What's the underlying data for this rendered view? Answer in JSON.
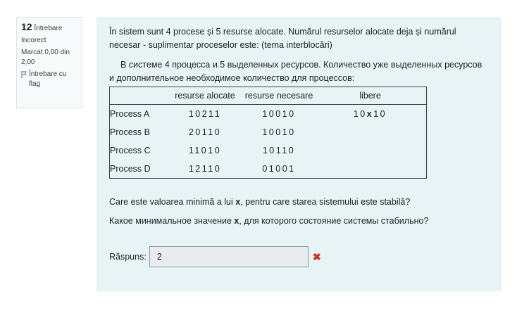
{
  "info": {
    "question_number": "12",
    "question_word": "Întrebare",
    "state": "Incorect",
    "grade": "Marcat 0,00 din 2,00",
    "flag_label": "Întrebare cu flag"
  },
  "question": {
    "text_ro": "În sistem sunt 4 procese și 5 resurse alocate. Numărul resurselor alocate deja și numărul necesar - suplimentar proceselor este:  (tema interblocări)",
    "text_ru": "В системе 4 процесса и 5 выделенных ресурсов. Количество уже выделенных ресурсов и дополнительное необходимое количество для процессов:",
    "table": {
      "headers": [
        "",
        "resurse alocate",
        "resurse necesare",
        "libere"
      ],
      "rows": [
        {
          "name": "Process A",
          "alocate": "10211",
          "necesare": "10010",
          "libere_pre": "10",
          "libere_x": "x",
          "libere_post": "10"
        },
        {
          "name": "Process B",
          "alocate": "20110",
          "necesare": "10010"
        },
        {
          "name": "Process C",
          "alocate": "11010",
          "necesare": "10110"
        },
        {
          "name": "Process D",
          "alocate": "12110",
          "necesare": "01001"
        }
      ]
    },
    "ask_ro_pre": "Care este valoarea minimă a lui ",
    "ask_ro_var": "x",
    "ask_ro_post": ", pentru care starea sistemului este stabilă?",
    "ask_ru_pre": "Какое минимальное значение ",
    "ask_ru_var": "x",
    "ask_ru_post": ", для которого состояние системы стабильно?"
  },
  "answer": {
    "label": "Răspuns:",
    "value": "2",
    "status_icon": "incorrect-x-icon",
    "status_color": "#ca3120"
  }
}
